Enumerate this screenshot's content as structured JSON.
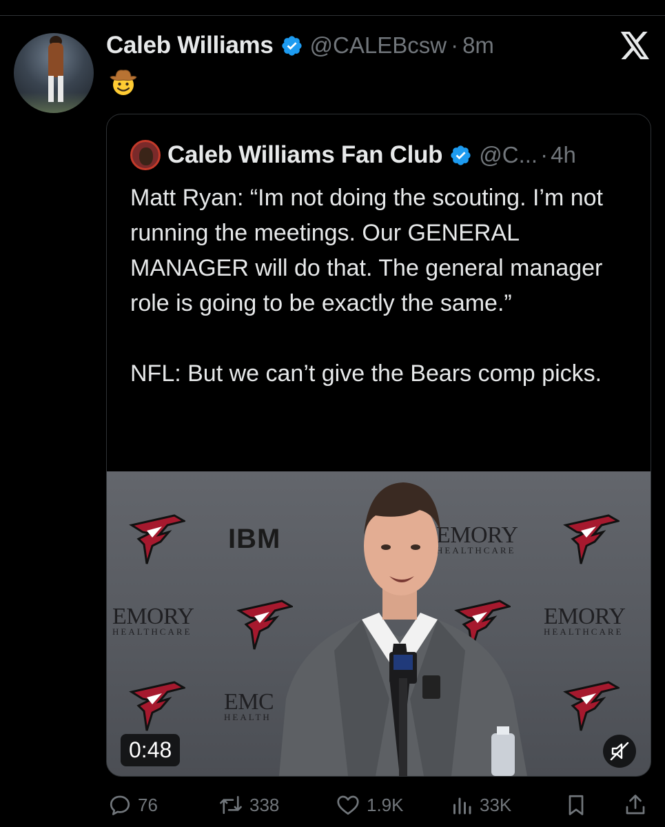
{
  "tweet": {
    "author_name": "Caleb Williams",
    "handle": "@CALEBcsw",
    "separator": "·",
    "time": "8m",
    "body_emoji": "cowboy-hat-face",
    "verified_color": "#1d9bf0"
  },
  "app": {
    "logo": "x-logo-icon"
  },
  "quote": {
    "author_name": "Caleb Williams Fan Club",
    "handle": "@C...",
    "separator": "·",
    "time": "4h",
    "text": "Matt Ryan: “Im not doing the scouting. I’m not running the meetings. Our GENERAL MANAGER will do that. The general manager role is going to be exactly the same.”\n\nNFL: But we can’t give the Bears comp picks.",
    "video": {
      "duration": "0:48",
      "muted": true,
      "backdrop_logos": {
        "emory": "EMORY",
        "emory_sub": "HEALTHCARE",
        "ibm": "IBM",
        "emory_partial": "EMC",
        "emory_sub_partial": "HEALTH"
      }
    }
  },
  "actions": {
    "replies": "76",
    "reposts": "338",
    "likes": "1.9K",
    "views": "33K"
  }
}
